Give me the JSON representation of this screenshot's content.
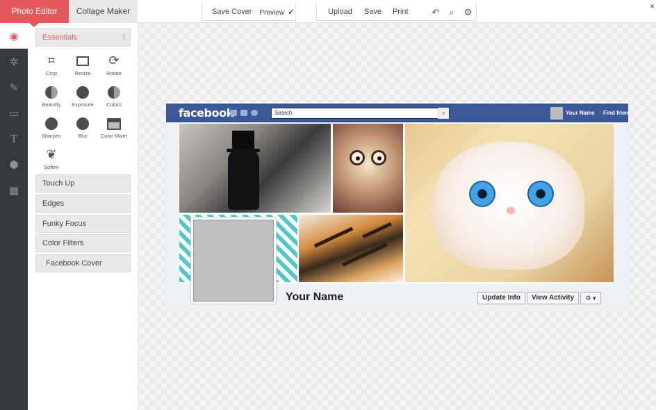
{
  "tabs": {
    "photo_editor": "Photo Editor",
    "collage_maker": "Collage Maker"
  },
  "toolbar": {
    "save_cover": "Save Cover",
    "preview": "Preview",
    "preview_checked": true,
    "upload": "Upload",
    "save": "Save",
    "print": "Print",
    "icons": [
      "undo-icon",
      "zoom-icon",
      "settings-gear-icon"
    ]
  },
  "rail": {
    "items": [
      "essentials-icon",
      "magic-wand-icon",
      "brush-icon",
      "frame-icon",
      "text-icon",
      "cube-icon",
      "texture-icon"
    ],
    "active": "essentials-icon"
  },
  "panel": {
    "essentials": "Essentials",
    "tools": [
      {
        "label": "Crop",
        "icon": "crop-icon"
      },
      {
        "label": "Resize",
        "icon": "resize-icon"
      },
      {
        "label": "Rotate",
        "icon": "rotate-icon"
      },
      {
        "label": "Beautify",
        "icon": "beautify-icon"
      },
      {
        "label": "Exposure",
        "icon": "exposure-icon"
      },
      {
        "label": "Colors",
        "icon": "colors-icon"
      },
      {
        "label": "Sharpen",
        "icon": "sharpen-icon"
      },
      {
        "label": "Blur",
        "icon": "blur-icon"
      },
      {
        "label": "Color Mixer",
        "icon": "color-mixer-icon"
      },
      {
        "label": "Soften",
        "icon": "soften-icon"
      }
    ],
    "sections": [
      "Touch Up",
      "Edges",
      "Funky Focus",
      "Color Filters",
      "Facebook Cover"
    ]
  },
  "facebook": {
    "logo": "facebook",
    "search_placeholder": "Search",
    "user_name": "Your Name",
    "find_friends": "Find friends",
    "profile_name": "Your Name",
    "update_info": "Update Info",
    "view_activity": "View Activity"
  },
  "colors": {
    "accent": "#e45a5a",
    "rail": "#353a3f",
    "facebook_blue": "#3b5998"
  }
}
